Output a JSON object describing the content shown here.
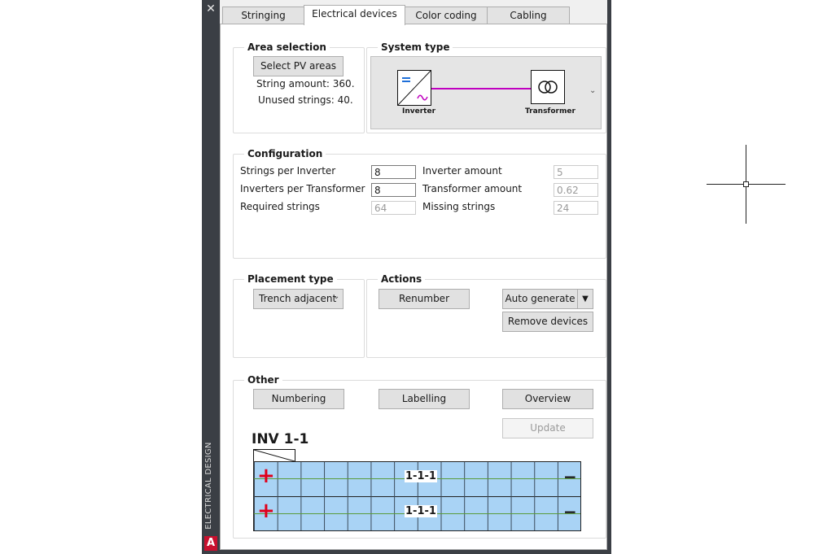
{
  "window": {
    "side_title": "ELECTRICAL DESIGN",
    "close_glyph": "✕",
    "logo_letter": "A"
  },
  "tabs": [
    {
      "label": "Stringing"
    },
    {
      "label": "Electrical devices"
    },
    {
      "label": "Color coding"
    },
    {
      "label": "Cabling"
    }
  ],
  "area_selection": {
    "title": "Area selection",
    "select_button": "Select PV areas",
    "string_amount": "String amount: 360.",
    "unused_strings": "Unused strings: 40."
  },
  "system_type": {
    "title": "System type",
    "inverter_label": "Inverter",
    "transformer_label": "Transformer",
    "connector_color": "#c000c0",
    "expand_icon": "chevron-down-icon"
  },
  "configuration": {
    "title": "Configuration",
    "strings_per_inverter_label": "Strings per Inverter",
    "strings_per_inverter_value": "8",
    "inverters_per_transformer_label": "Inverters per Transformer",
    "inverters_per_transformer_value": "8",
    "required_strings_label": "Required strings",
    "required_strings_value": "64",
    "inverter_amount_label": "Inverter amount",
    "inverter_amount_value": "5",
    "transformer_amount_label": "Transformer amount",
    "transformer_amount_value": "0.62",
    "missing_strings_label": "Missing strings",
    "missing_strings_value": "24"
  },
  "placement_type": {
    "title": "Placement type",
    "selected": "Trench adjacent"
  },
  "actions": {
    "title": "Actions",
    "renumber": "Renumber",
    "auto_generate": "Auto generate",
    "remove_devices": "Remove devices"
  },
  "other": {
    "title": "Other",
    "numbering": "Numbering",
    "labelling": "Labelling",
    "overview": "Overview",
    "update": "Update"
  },
  "preview": {
    "inverter_tag": "INV 1-1",
    "row1_label": "1-1-1",
    "row2_label": "1-1-1",
    "plus_glyph": "+",
    "minus_glyph": "−",
    "panel_color": "#a9d3f5",
    "plus_color": "#e0001b"
  }
}
